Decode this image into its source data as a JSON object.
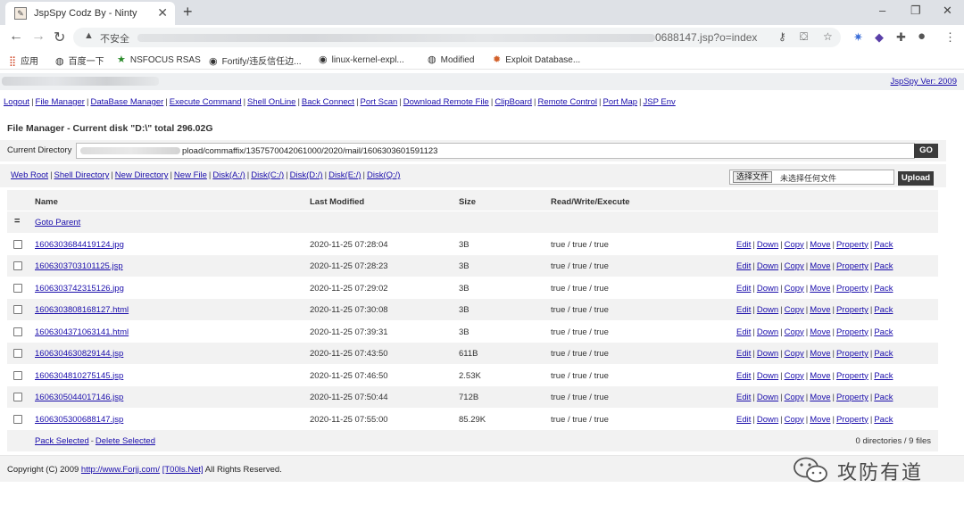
{
  "browser": {
    "tab_title": "JspSpy Codz By - Ninty",
    "tab_close": "✕",
    "new_tab": "+",
    "window_controls": [
      "–",
      "❐",
      "✕"
    ],
    "insecure_label": "不安全",
    "url_tail": "0688147.jsp?o=index",
    "bookmarks": [
      {
        "icon": "apps-grid-icon",
        "label": "应用"
      },
      {
        "icon": "globe-icon",
        "label": "百度一下"
      },
      {
        "icon": "star-icon",
        "label": "NSFOCUS RSAS"
      },
      {
        "icon": "github-icon",
        "label": "Fortify/违反信任边..."
      },
      {
        "icon": "github-icon",
        "label": "linux-kernel-expl..."
      },
      {
        "icon": "globe-icon",
        "label": "Modified"
      },
      {
        "icon": "bug-icon",
        "label": "Exploit Database..."
      }
    ]
  },
  "page": {
    "version_link": "JspSpy Ver: 2009",
    "menu": [
      "Logout",
      "File Manager",
      "DataBase Manager",
      "Execute Command",
      "Shell OnLine",
      "Back Connect",
      "Port Scan",
      "Download Remote File",
      "ClipBoard",
      "Remote Control",
      "Port Map",
      "JSP Env"
    ],
    "title": "File Manager - Current disk \"D:\\\" total 296.02G",
    "current_directory_label": "Current Directory",
    "current_directory_value": "pload/commaffix/1357570042061000/2020/mail/1606303601591123",
    "go_label": "GO",
    "subnav": [
      "Web Root",
      "Shell Directory",
      "New Directory",
      "New File",
      "Disk(A:/)",
      "Disk(C:/)",
      "Disk(D:/)",
      "Disk(E:/)",
      "Disk(Q:/)"
    ],
    "choose_file_label": "选择文件",
    "no_file_label": "未选择任何文件",
    "upload_label": "Upload",
    "columns": [
      "Name",
      "Last Modified",
      "Size",
      "Read/Write/Execute"
    ],
    "parent_symbol": "=",
    "goto_parent": "Goto Parent",
    "actions": [
      "Edit",
      "Down",
      "Copy",
      "Move",
      "Property",
      "Pack"
    ],
    "files": [
      {
        "name": "1606303684419124.jpg",
        "modified": "2020-11-25 07:28:04",
        "size": "3B",
        "rwx": "true / true / true"
      },
      {
        "name": "1606303703101125.jsp",
        "modified": "2020-11-25 07:28:23",
        "size": "3B",
        "rwx": "true / true / true"
      },
      {
        "name": "1606303742315126.jpg",
        "modified": "2020-11-25 07:29:02",
        "size": "3B",
        "rwx": "true / true / true"
      },
      {
        "name": "1606303808168127.html",
        "modified": "2020-11-25 07:30:08",
        "size": "3B",
        "rwx": "true / true / true"
      },
      {
        "name": "1606304371063141.html",
        "modified": "2020-11-25 07:39:31",
        "size": "3B",
        "rwx": "true / true / true"
      },
      {
        "name": "1606304630829144.jsp",
        "modified": "2020-11-25 07:43:50",
        "size": "611B",
        "rwx": "true / true / true"
      },
      {
        "name": "1606304810275145.jsp",
        "modified": "2020-11-25 07:46:50",
        "size": "2.53K",
        "rwx": "true / true / true"
      },
      {
        "name": "1606305044017146.jsp",
        "modified": "2020-11-25 07:50:44",
        "size": "712B",
        "rwx": "true / true / true"
      },
      {
        "name": "1606305300688147.jsp",
        "modified": "2020-11-25 07:55:00",
        "size": "85.29K",
        "rwx": "true / true / true"
      }
    ],
    "pack_selected": "Pack Selected",
    "delete_selected": "Delete Selected",
    "file_count": "0 directories / 9 files",
    "copyright_prefix": "Copyright (C) 2009",
    "copyright_link1": "http://www.Forjj.com/",
    "copyright_link2": "[T00ls.Net]",
    "copyright_suffix": "All Rights Reserved."
  },
  "watermark": {
    "text": "攻防有道"
  }
}
